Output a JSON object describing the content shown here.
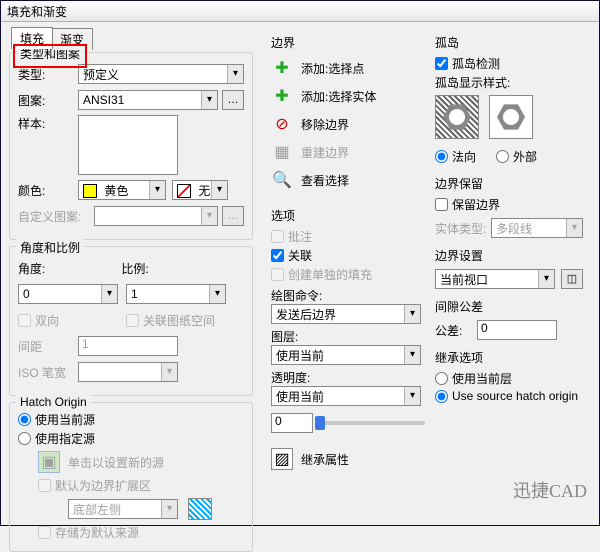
{
  "window": {
    "title": "填充和渐变"
  },
  "tabs": {
    "fill": "填充",
    "gradient": "渐变"
  },
  "typePattern": {
    "group_label": "类型和图案",
    "type_label": "类型:",
    "type_value": "预定义",
    "pattern_label": "图案:",
    "pattern_value": "ANSI31",
    "sample_label": "样本:",
    "color_label": "颜色:",
    "color_value": "黄色",
    "none_label": "无",
    "custom_label": "自定义图案:"
  },
  "angleScale": {
    "group_label": "角度和比例",
    "angle_label": "角度:",
    "angle_value": "0",
    "scale_label": "比例:",
    "scale_value": "1",
    "bidir_label": "双向",
    "paper_label": "关联图纸空间",
    "spacing_label": "间距",
    "spacing_value": "1",
    "isopen_label": "ISO 笔宽"
  },
  "origin": {
    "group_label": "Hatch Origin",
    "use_current": "使用当前源",
    "use_specified": "使用指定源",
    "click_new": "单击以设置新的源",
    "default_ext": "默认为边界扩展区",
    "bottom_left": "底部左侧",
    "store_default": "存储为默认来源"
  },
  "boundary": {
    "title": "边界",
    "add_pick": "添加:选择点",
    "add_select": "添加:选择实体",
    "remove": "移除边界",
    "rebuild": "重建边界",
    "view_sel": "查看选择"
  },
  "options": {
    "title": "选项",
    "annotate": "批注",
    "assoc": "关联",
    "separate": "创建单独的填充",
    "draw_order": "绘图命令:",
    "draw_order_value": "发送后边界",
    "layer": "图层:",
    "layer_value": "使用当前",
    "transparency": "透明度:",
    "transparency_value": "使用当前",
    "trans_num": "0"
  },
  "inherit_btn": "继承属性",
  "islands": {
    "title": "孤岛",
    "detect": "孤岛检测",
    "display_style": "孤岛显示样式:",
    "normal": "法向",
    "outer": "外部"
  },
  "bretain": {
    "title": "边界保留",
    "retain": "保留边界",
    "entity_type": "实体类型:",
    "entity_value": "多段线"
  },
  "bset": {
    "title": "边界设置",
    "viewport": "当前视口"
  },
  "gap": {
    "title": "间隙公差",
    "tol_label": "公差:",
    "tol_value": "0"
  },
  "inherit": {
    "title": "继承选项",
    "use_layer": "使用当前层",
    "use_source": "Use source hatch origin"
  },
  "brand": "迅捷CAD"
}
